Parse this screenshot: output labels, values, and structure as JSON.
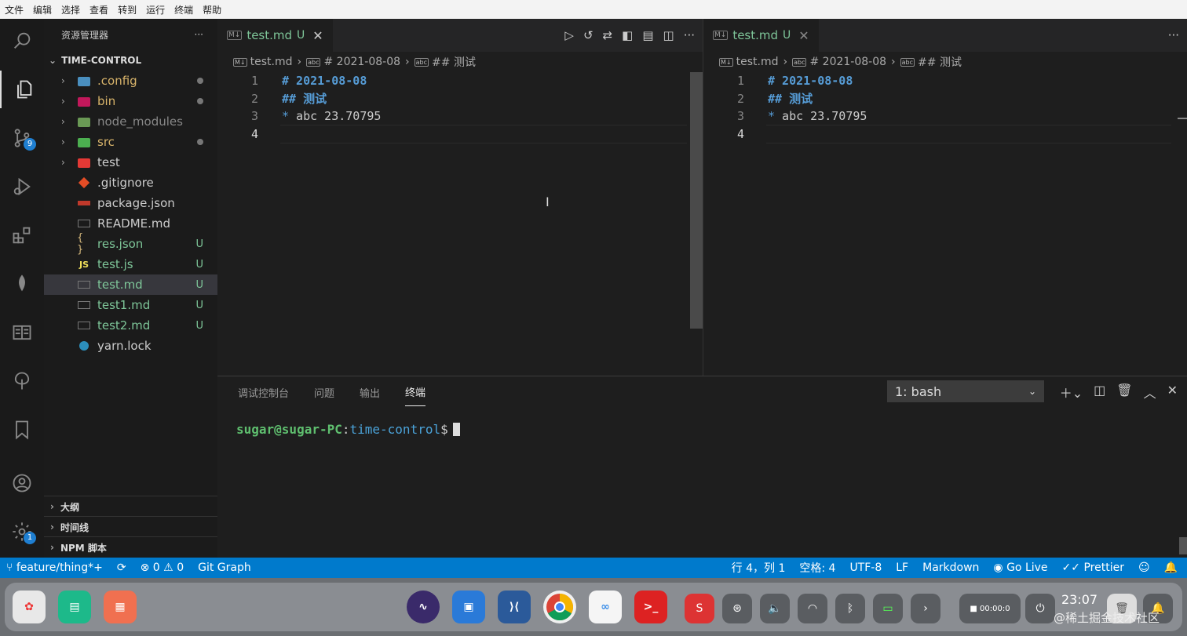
{
  "menu": [
    "文件",
    "编辑",
    "选择",
    "查看",
    "转到",
    "运行",
    "终端",
    "帮助"
  ],
  "activity": {
    "scm_badge": "9",
    "settings_badge": "1"
  },
  "explorer": {
    "title": "资源管理器",
    "more": "···",
    "folder": "TIME-CONTROL",
    "items": [
      {
        "name": ".config",
        "status": ""
      },
      {
        "name": "bin",
        "status": ""
      },
      {
        "name": "node_modules",
        "status": ""
      },
      {
        "name": "src",
        "status": ""
      },
      {
        "name": "test",
        "status": ""
      },
      {
        "name": ".gitignore",
        "status": ""
      },
      {
        "name": "package.json",
        "status": ""
      },
      {
        "name": "README.md",
        "status": ""
      },
      {
        "name": "res.json",
        "status": "U"
      },
      {
        "name": "test.js",
        "status": "U"
      },
      {
        "name": "test.md",
        "status": "U"
      },
      {
        "name": "test1.md",
        "status": "U"
      },
      {
        "name": "test2.md",
        "status": "U"
      },
      {
        "name": "yarn.lock",
        "status": ""
      }
    ],
    "sections": [
      "大纲",
      "时间线",
      "NPM 脚本"
    ]
  },
  "editor_left": {
    "tab": "test.md",
    "tab_status": "U",
    "crumbs": [
      "test.md",
      "# 2021-08-08",
      "## 测试"
    ],
    "lines": [
      {
        "n": "1",
        "t": "# 2021-08-08"
      },
      {
        "n": "2",
        "t": "## 测试"
      },
      {
        "n": "3",
        "b": "*",
        "t": " abc 23.70795"
      },
      {
        "n": "4",
        "t": ""
      }
    ]
  },
  "editor_right": {
    "tab": "test.md",
    "tab_status": "U",
    "crumbs": [
      "test.md",
      "# 2021-08-08",
      "## 测试"
    ],
    "lines": [
      {
        "n": "1",
        "t": "# 2021-08-08"
      },
      {
        "n": "2",
        "t": "## 测试"
      },
      {
        "n": "3",
        "b": "*",
        "t": " abc 23.70795"
      },
      {
        "n": "4",
        "t": ""
      }
    ]
  },
  "panel": {
    "tabs": [
      "调试控制台",
      "问题",
      "输出",
      "终端"
    ],
    "terminal_select": "1: bash",
    "prompt_user": "sugar@sugar-PC",
    "prompt_colon": ":",
    "prompt_path": "time-control",
    "prompt_dollar": "$"
  },
  "statusbar": {
    "branch": "feature/thing*+",
    "errors": "0",
    "warnings": "0",
    "git_graph": "Git Graph",
    "position": "行 4，列 1",
    "spaces": "空格: 4",
    "encoding": "UTF-8",
    "eol": "LF",
    "language": "Markdown",
    "golive": "Go Live",
    "prettier": "Prettier"
  },
  "taskbar": {
    "time": "23:07",
    "record": "00:00:0",
    "watermark": "@稀土掘金技术社区"
  },
  "colors": {
    "accent": "#007acc",
    "untracked": "#7ec699",
    "heading": "#569cd6"
  }
}
